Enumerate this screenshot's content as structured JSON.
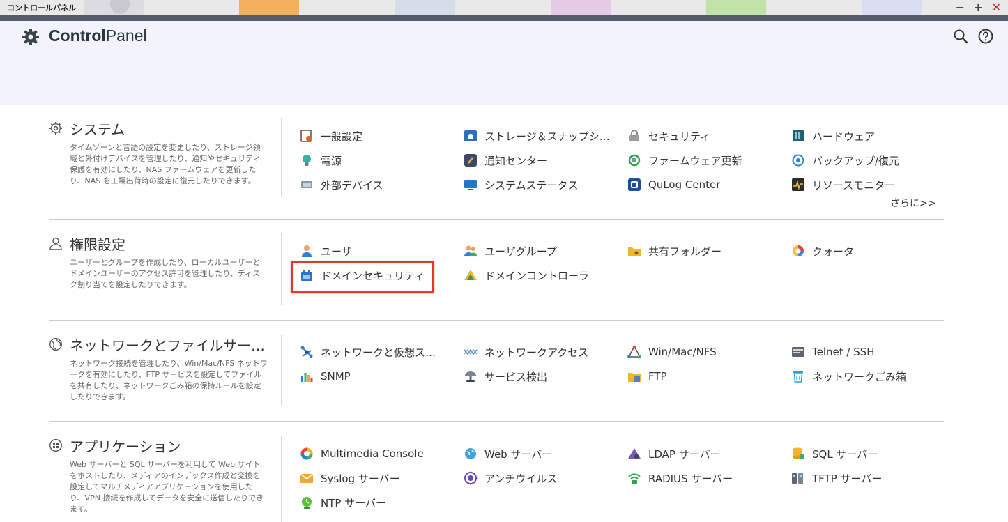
{
  "window": {
    "title": "コントロールパネル",
    "minimize": "−",
    "maximize": "+",
    "close": "✕"
  },
  "header": {
    "title_bold": "Control",
    "title_rest": "Panel"
  },
  "sections": {
    "system": {
      "title": "システム",
      "description": "タイムゾーンと言語の設定を変更したり、ストレージ領域と外付けデバイスを管理したり、通知やセキュリティ保護を有効にしたり、NAS ファームウェアを更新したり、NAS を工場出荷時の設定に復元したりできます。",
      "items": [
        {
          "label": "一般設定"
        },
        {
          "label": "ストレージ＆スナップショット"
        },
        {
          "label": "セキュリティ"
        },
        {
          "label": "ハードウェア"
        },
        {
          "label": "電源"
        },
        {
          "label": "通知センター"
        },
        {
          "label": "ファームウェア更新"
        },
        {
          "label": "バックアップ/復元"
        },
        {
          "label": "外部デバイス"
        },
        {
          "label": "システムステータス"
        },
        {
          "label": "QuLog Center"
        },
        {
          "label": "リソースモニター"
        }
      ],
      "more": "さらに>>"
    },
    "privilege": {
      "title": "権限設定",
      "description": "ユーザーとグループを作成したり、ローカルユーザーとドメインユーザーのアクセス許可を管理したり、ディスク割り当てを設定したりできます。",
      "items": [
        {
          "label": "ユーザ"
        },
        {
          "label": "ユーザグループ"
        },
        {
          "label": "共有フォルダー"
        },
        {
          "label": "クォータ"
        },
        {
          "label": "ドメインセキュリティ"
        },
        {
          "label": "ドメインコントローラ"
        }
      ]
    },
    "network": {
      "title": "ネットワークとファイルサービス",
      "description": "ネットワーク接続を管理したり、Win/Mac/NFS ネットワークを有効にしたり、FTP サービスを設定してファイルを共有したり、ネットワークごみ箱の保持ルールを設定したりできます。",
      "items": [
        {
          "label": "ネットワークと仮想スイッチ"
        },
        {
          "label": "ネットワークアクセス"
        },
        {
          "label": "Win/Mac/NFS"
        },
        {
          "label": "Telnet / SSH"
        },
        {
          "label": "SNMP"
        },
        {
          "label": "サービス検出"
        },
        {
          "label": "FTP"
        },
        {
          "label": "ネットワークごみ箱"
        }
      ]
    },
    "apps": {
      "title": "アプリケーション",
      "description": "Web サーバーと SQL サーバーを利用して Web サイトをホストしたり、メディアのインデックス作成と変換を設定してマルチメディアアプリケーションを使用したり、VPN 接続を作成してデータを安全に送信したりできます。",
      "items": [
        {
          "label": "Multimedia Console"
        },
        {
          "label": "Web サーバー"
        },
        {
          "label": "LDAP サーバー"
        },
        {
          "label": "SQL サーバー"
        },
        {
          "label": "Syslog サーバー"
        },
        {
          "label": "アンチウイルス"
        },
        {
          "label": "RADIUS サーバー"
        },
        {
          "label": "TFTP サーバー"
        },
        {
          "label": "NTP サーバー"
        }
      ]
    }
  },
  "colors": {
    "highlight": "#e8342a",
    "header_bg": "#f1f4fb"
  }
}
